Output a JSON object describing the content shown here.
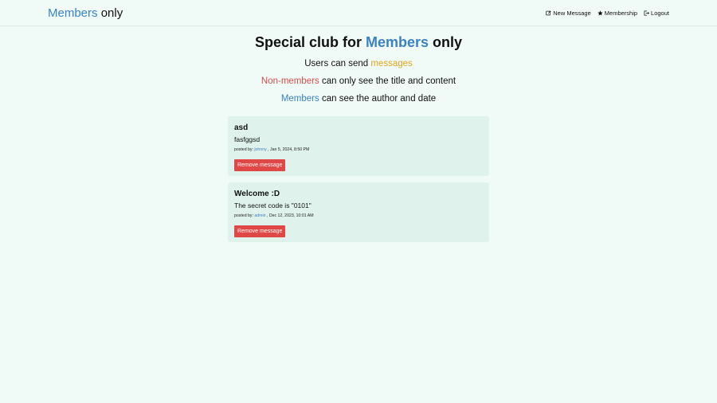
{
  "navbar": {
    "brand_accent": "Members",
    "brand_rest": "only",
    "links": [
      {
        "label": "New Message",
        "icon": "edit-icon"
      },
      {
        "label": "Membership",
        "icon": "star-icon"
      },
      {
        "label": "Logout",
        "icon": "logout-icon"
      }
    ]
  },
  "hero": {
    "title_pre": "Special club for",
    "title_accent": "Members",
    "title_post": "only",
    "line1_pre": "Users can send",
    "line1_accent": "messages",
    "line2_accent": "Non-members",
    "line2_post": "can only see the title and content",
    "line3_accent": "Members",
    "line3_post": "can see the author and date"
  },
  "messages": [
    {
      "title": "asd",
      "content": "fasfggsd",
      "meta_pre": "posted by:",
      "author": "johnny",
      "date": ", Jan 5, 2024, 8:50 PM",
      "remove_label": "Remove message"
    },
    {
      "title": "Welcome :D",
      "content": "The secret code is \"0101\"",
      "meta_pre": "posted by:",
      "author": "admin",
      "date": ", Dec 12, 2023, 10:01 AM",
      "remove_label": "Remove message"
    }
  ],
  "colors": {
    "background": "#f0fbf8",
    "card": "#e0f2ec",
    "accent_blue": "#3b82c4",
    "accent_orange": "#e0a51f",
    "accent_red": "#d94a4a",
    "button_red": "#e04848"
  }
}
